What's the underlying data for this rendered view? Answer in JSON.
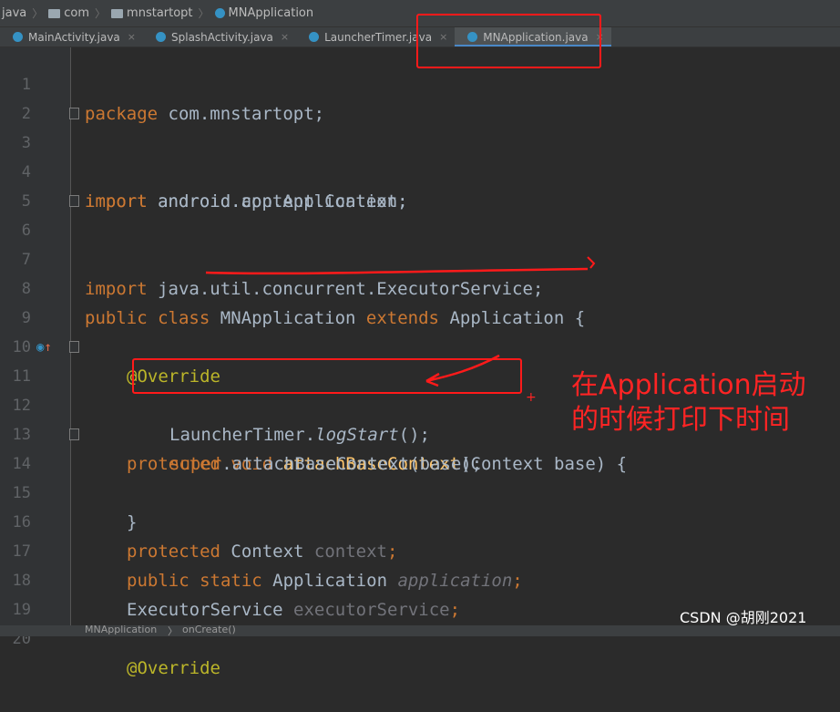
{
  "breadcrumb": {
    "items": [
      "java",
      "com",
      "mnstartopt",
      "MNApplication"
    ],
    "separator": "〉"
  },
  "tabs": [
    {
      "label": "MainActivity.java",
      "close": "×",
      "active": false
    },
    {
      "label": "SplashActivity.java",
      "close": "×",
      "active": false
    },
    {
      "label": "LauncherTimer.java",
      "close": "×",
      "active": false
    },
    {
      "label": "MNApplication.java",
      "close": "×",
      "active": true
    }
  ],
  "code": {
    "line_numbers": [
      "1",
      "2",
      "3",
      "4",
      "5",
      "6",
      "7",
      "8",
      "9",
      "10",
      "11",
      "12",
      "13",
      "14",
      "15",
      "16",
      "17",
      "18",
      "19",
      "20"
    ],
    "l1_kw": "package",
    "l1_rest": " com.mnstartopt;",
    "l3_kw": "import",
    "l3_rest": " android.app.Application;",
    "l4_kw": "import",
    "l4_rest": " android.content.Context;",
    "l6_kw": "import",
    "l6_rest": " java.util.concurrent.ExecutorService;",
    "l8_kw1": "public",
    "l8_kw2": "class",
    "l8_name": "MNApplication",
    "l8_kw3": "extends",
    "l8_rest": "Application {",
    "l10_ann": "@Override",
    "l11_kw1": "protected",
    "l11_kw2": "void",
    "l11_fn": "attachBaseContext",
    "l11_rest": "(Context base) {",
    "l12_cls": "LauncherTimer.",
    "l12_method": "logStart",
    "l12_rest": "();",
    "l13_kw": "super",
    "l13_rest": ".attachBaseContext(base);",
    "l14": "}",
    "l16_kw": "protected",
    "l16_type": " Context ",
    "l16_field": "context",
    "l16_end": ";",
    "l17_kw1": "public",
    "l17_kw2": "static",
    "l17_type": " Application ",
    "l17_field": "application",
    "l17_end": ";",
    "l18_type": "ExecutorService ",
    "l18_field": "executorService",
    "l18_end": ";",
    "l20_ann": "@Override"
  },
  "status": {
    "class_crumb": "MNApplication",
    "sep": "〉",
    "method_crumb": "onCreate()"
  },
  "annotation": {
    "note_line1": "在Application启动",
    "note_line2": "的时候打印下时间",
    "plus": "+"
  },
  "watermark": "CSDN @胡刚2021",
  "colors": {
    "keyword": "#cc7832",
    "annotation": "#bbb529",
    "function": "#ffc66d",
    "field": "#9876aa",
    "markup": "#ff1a1a"
  }
}
